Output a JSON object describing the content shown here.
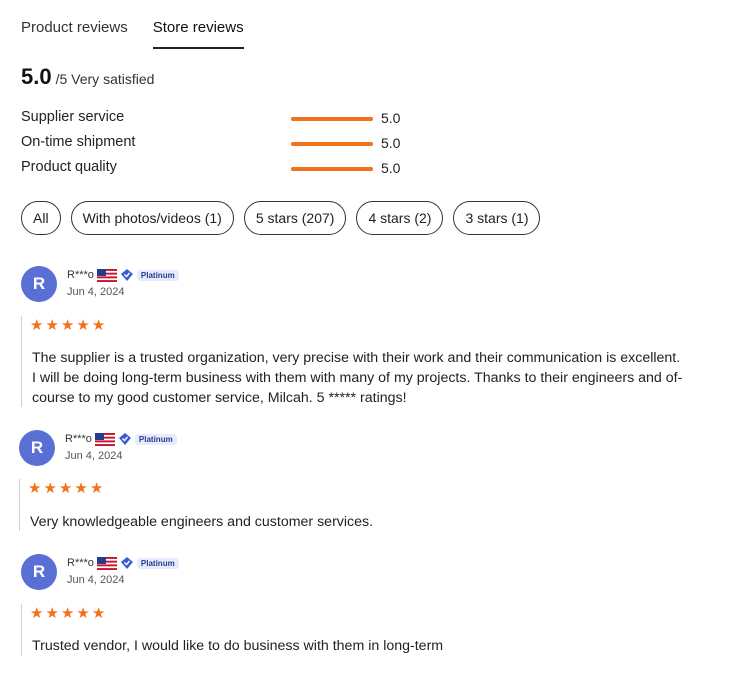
{
  "tabs": [
    {
      "label": "Product reviews",
      "active": false
    },
    {
      "label": "Store reviews",
      "active": true
    }
  ],
  "summary": {
    "score": "5.0",
    "suffix": "/5 Very satisfied"
  },
  "metrics": [
    {
      "label": "Supplier service",
      "value": "5.0",
      "level": 1.0
    },
    {
      "label": "On-time shipment",
      "value": "5.0",
      "level": 1.0
    },
    {
      "label": "Product quality",
      "value": "5.0",
      "level": 1.0
    }
  ],
  "filters": [
    "All",
    "With photos/videos (1)",
    "5 stars (207)",
    "4 stars (2)",
    "3 stars (1)"
  ],
  "reviews": [
    {
      "initial": "R",
      "name": "R***o",
      "badge": "Platinum",
      "date": "Jun 4, 2024",
      "stars": 5,
      "lines": [
        "The supplier is a trusted organization, very precise with their work and their communication is excellent.",
        "I will be doing long-term business with them with many of my projects. Thanks to their engineers and of-",
        "course to my good customer service, Milcah. 5 ***** ratings!"
      ]
    },
    {
      "initial": "R",
      "name": "R***o",
      "badge": "Platinum",
      "date": "Jun 4, 2024",
      "stars": 5,
      "lines": [
        "Very knowledgeable engineers and customer services."
      ]
    },
    {
      "initial": "R",
      "name": "R***o",
      "badge": "Platinum",
      "date": "Jun 4, 2024",
      "stars": 5,
      "lines": [
        "Trusted vendor, I would like to do business with them in long-term"
      ]
    }
  ],
  "colors": {
    "accent": "#f2711c",
    "avatar": "#5a6fd6"
  },
  "icons": {
    "flag": "us-flag-icon",
    "verified": "verified-diamond-icon",
    "star": "star-icon"
  }
}
